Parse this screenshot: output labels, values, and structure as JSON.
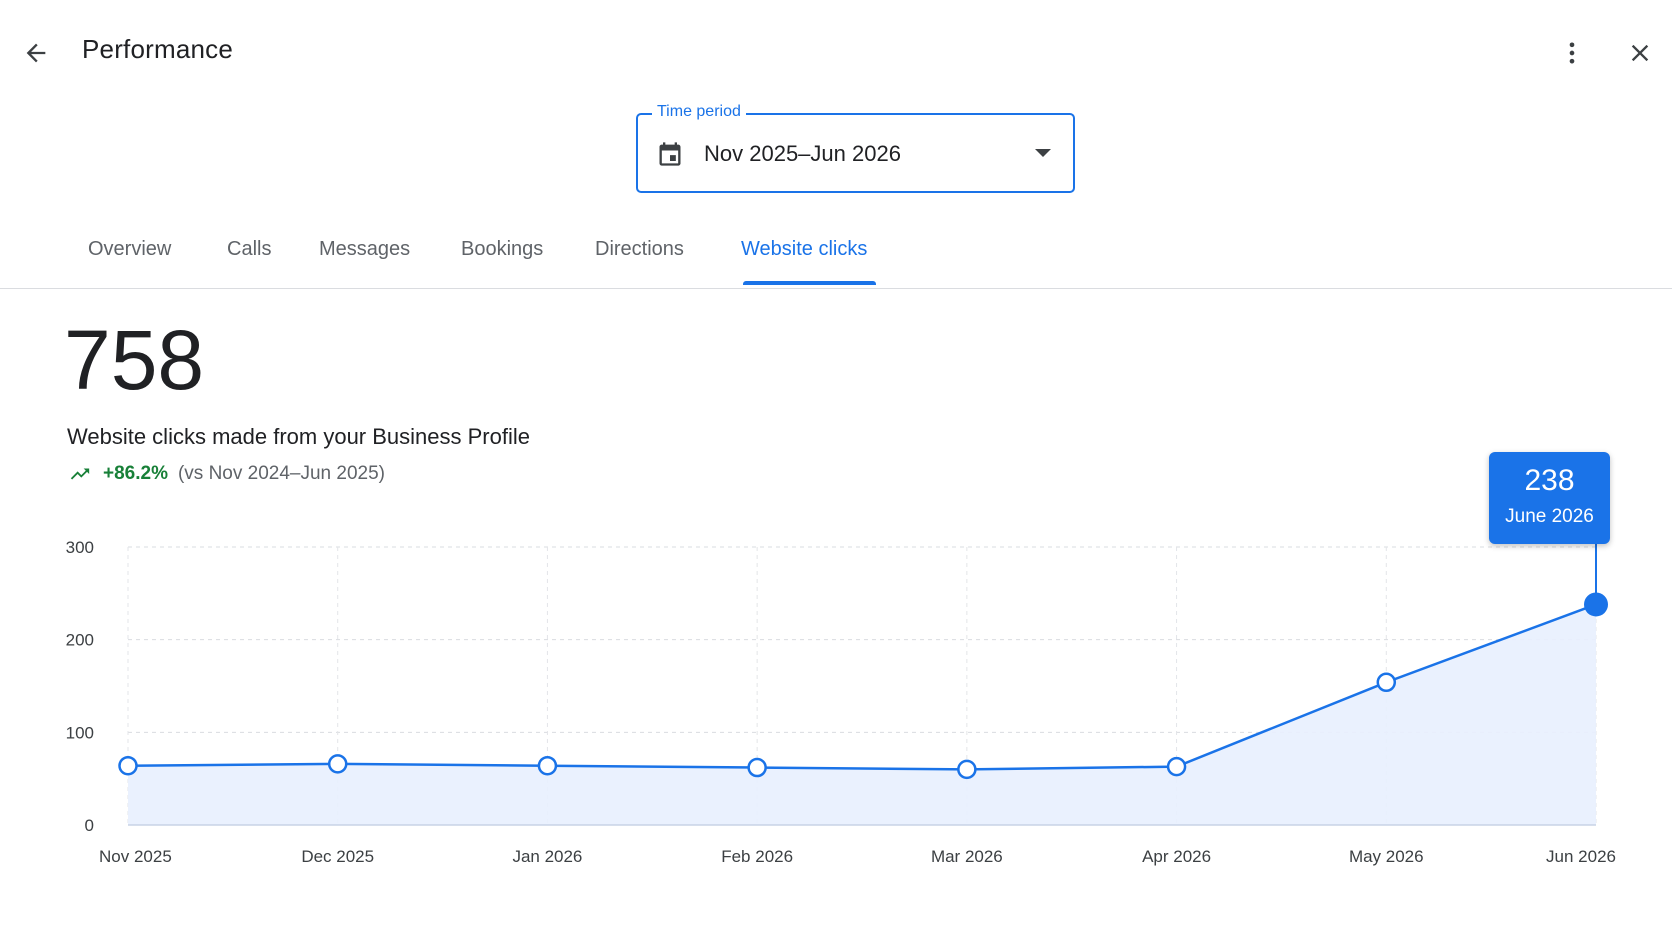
{
  "header": {
    "title": "Performance",
    "back_icon": "arrow-back-icon",
    "more_icon": "more-vert-icon",
    "close_icon": "close-icon"
  },
  "time_period": {
    "label": "Time period",
    "value": "Nov 2025–Jun 2026",
    "icon": "calendar-icon"
  },
  "tabs": [
    {
      "label": "Overview",
      "active": false
    },
    {
      "label": "Calls",
      "active": false
    },
    {
      "label": "Messages",
      "active": false
    },
    {
      "label": "Bookings",
      "active": false
    },
    {
      "label": "Directions",
      "active": false
    },
    {
      "label": "Website clicks",
      "active": true
    }
  ],
  "summary": {
    "total": "758",
    "description": "Website clicks made from your Business Profile",
    "change_pct": "+86.2%",
    "comparison": "(vs Nov 2024–Jun 2025)",
    "trend_icon": "trending-up-icon"
  },
  "tooltip": {
    "value": "238",
    "label": "June 2026"
  },
  "colors": {
    "accent": "#1a73e8",
    "positive": "#188038",
    "area_fill": "#e8f0fe"
  },
  "chart_data": {
    "type": "area",
    "x": [
      "Nov 2025",
      "Dec 2025",
      "Jan 2026",
      "Feb 2026",
      "Mar 2026",
      "Apr 2026",
      "May 2026",
      "Jun 2026"
    ],
    "series": [
      {
        "values": [
          64,
          66,
          64,
          62,
          60,
          63,
          154,
          238
        ]
      }
    ],
    "yticks": [
      "0",
      "100",
      "200",
      "300"
    ],
    "ylim": [
      0,
      300
    ],
    "grid": true,
    "highlighted_point": "Jun 2026"
  }
}
